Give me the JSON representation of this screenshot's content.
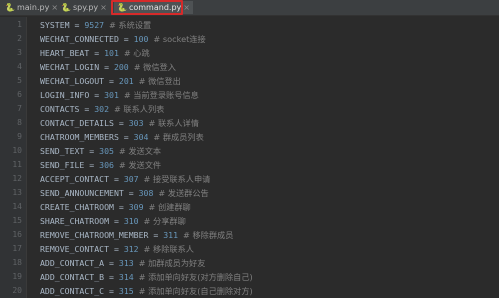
{
  "tabs": [
    {
      "label": "main.py",
      "icon": "python-file-icon"
    },
    {
      "label": "spy.py",
      "icon": "python-file-icon"
    },
    {
      "label": "command.py",
      "icon": "python-file-icon",
      "active": true
    }
  ],
  "close_glyph": "×",
  "lines": [
    {
      "n": "1",
      "name": "SYSTEM",
      "value": "9527",
      "comment": "# 系统设置"
    },
    {
      "n": "2",
      "name": "WECHAT_CONNECTED",
      "value": "100",
      "comment": "# socket连接"
    },
    {
      "n": "3",
      "name": "HEART_BEAT",
      "value": "101",
      "comment": "# 心跳"
    },
    {
      "n": "4",
      "name": "WECHAT_LOGIN",
      "value": "200",
      "comment": "# 微信登入"
    },
    {
      "n": "5",
      "name": "WECHAT_LOGOUT",
      "value": "201",
      "comment": "# 微信登出"
    },
    {
      "n": "6",
      "name": "LOGIN_INFO",
      "value": "301",
      "comment": "# 当前登录账号信息"
    },
    {
      "n": "7",
      "name": "CONTACTS",
      "value": "302",
      "comment": "# 联系人列表"
    },
    {
      "n": "8",
      "name": "CONTACT_DETAILS",
      "value": "303",
      "comment": "# 联系人详情"
    },
    {
      "n": "9",
      "name": "CHATROOM_MEMBERS",
      "value": "304",
      "comment": "# 群成员列表"
    },
    {
      "n": "10",
      "name": "SEND_TEXT",
      "value": "305",
      "comment": "# 发送文本"
    },
    {
      "n": "11",
      "name": "SEND_FILE",
      "value": "306",
      "comment": "# 发送文件"
    },
    {
      "n": "12",
      "name": "ACCEPT_CONTACT",
      "value": "307",
      "comment": "# 接受联系人申请"
    },
    {
      "n": "13",
      "name": "SEND_ANNOUNCEMENT",
      "value": "308",
      "comment": "# 发送群公告"
    },
    {
      "n": "14",
      "name": "CREATE_CHATROOM",
      "value": "309",
      "comment": "# 创建群聊"
    },
    {
      "n": "15",
      "name": "SHARE_CHATROOM",
      "value": "310",
      "comment": "# 分享群聊"
    },
    {
      "n": "16",
      "name": "REMOVE_CHATROOM_MEMBER",
      "value": "311",
      "comment": "# 移除群成员"
    },
    {
      "n": "17",
      "name": "REMOVE_CONTACT",
      "value": "312",
      "comment": "# 移除联系人"
    },
    {
      "n": "18",
      "name": "ADD_CONTACT_A",
      "value": "313",
      "comment": "# 加群成员为好友"
    },
    {
      "n": "19",
      "name": "ADD_CONTACT_B",
      "value": "314",
      "comment": "# 添加单向好友(对方删除自己)"
    },
    {
      "n": "20",
      "name": "ADD_CONTACT_C",
      "value": "315",
      "comment": "# 添加单向好友(自己删除对方)"
    }
  ]
}
